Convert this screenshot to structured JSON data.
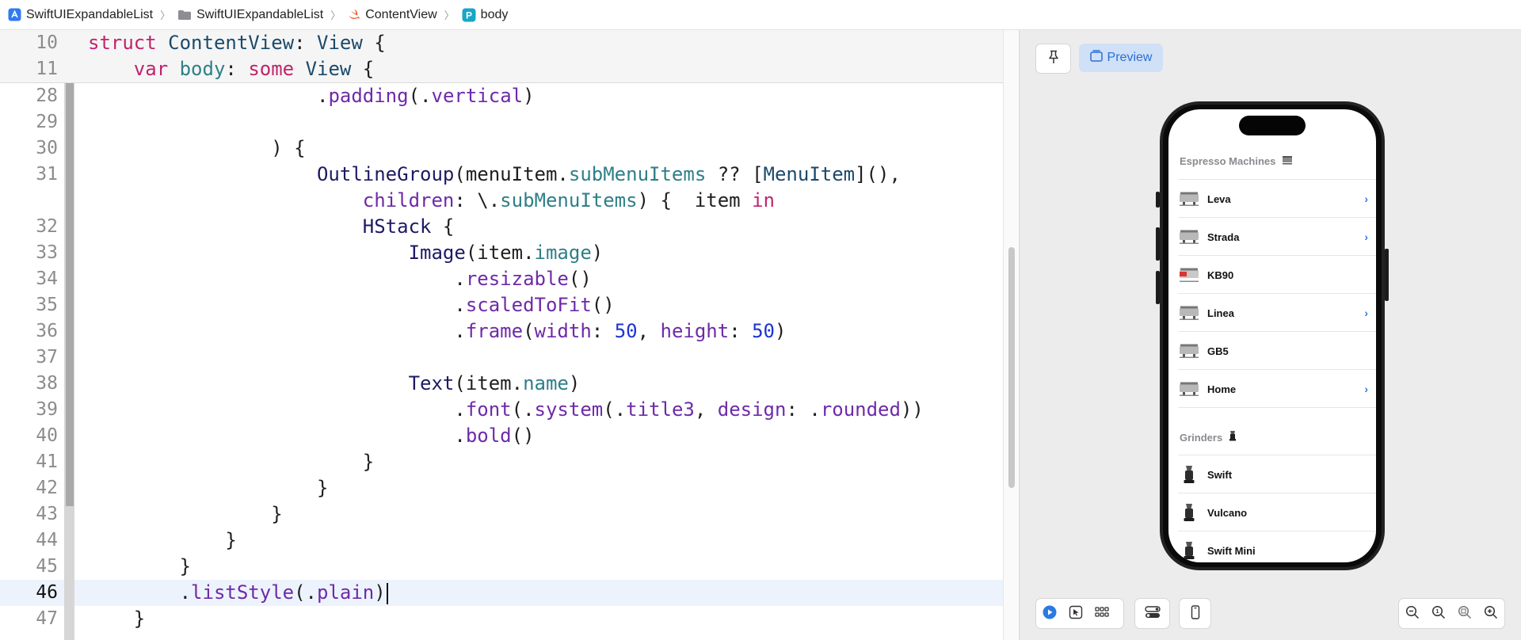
{
  "breadcrumb": [
    {
      "label": "SwiftUIExpandableList",
      "icon": "app-icon"
    },
    {
      "label": "SwiftUIExpandableList",
      "icon": "folder-icon"
    },
    {
      "label": "ContentView",
      "icon": "swift-file-icon"
    },
    {
      "label": "body",
      "icon": "property-icon",
      "badge": "P"
    }
  ],
  "editor": {
    "sticky": [
      {
        "num": "10",
        "code": "struct ContentView: View {"
      },
      {
        "num": "11",
        "code": "    var body: some View {"
      }
    ],
    "lines": [
      {
        "num": "28",
        "code": "                    .padding(.vertical)"
      },
      {
        "num": "29",
        "code": ""
      },
      {
        "num": "30",
        "code": "                ) {"
      },
      {
        "num": "31",
        "code": "                    OutlineGroup(menuItem.subMenuItems ?? [MenuItem](),"
      },
      {
        "num": "",
        "code": "                        children: \\.subMenuItems) {  item in"
      },
      {
        "num": "32",
        "code": "                        HStack {"
      },
      {
        "num": "33",
        "code": "                            Image(item.image)"
      },
      {
        "num": "34",
        "code": "                                .resizable()"
      },
      {
        "num": "35",
        "code": "                                .scaledToFit()"
      },
      {
        "num": "36",
        "code": "                                .frame(width: 50, height: 50)"
      },
      {
        "num": "37",
        "code": ""
      },
      {
        "num": "38",
        "code": "                            Text(item.name)"
      },
      {
        "num": "39",
        "code": "                                .font(.system(.title3, design: .rounded))"
      },
      {
        "num": "40",
        "code": "                                .bold()"
      },
      {
        "num": "41",
        "code": "                        }"
      },
      {
        "num": "42",
        "code": "                    }"
      },
      {
        "num": "43",
        "code": "                }"
      },
      {
        "num": "44",
        "code": "            }"
      },
      {
        "num": "45",
        "code": "        }"
      },
      {
        "num": "46",
        "code": "        .listStyle(.plain)"
      },
      {
        "num": "47",
        "code": "    }"
      }
    ],
    "current_line": "46"
  },
  "preview": {
    "pin_icon": "pin-icon",
    "preview_label": "Preview",
    "sections": [
      {
        "title": "Espresso Machines",
        "items": [
          {
            "name": "Leva",
            "expandable": true
          },
          {
            "name": "Strada",
            "expandable": true
          },
          {
            "name": "KB90",
            "expandable": false
          },
          {
            "name": "Linea",
            "expandable": true
          },
          {
            "name": "GB5",
            "expandable": false
          },
          {
            "name": "Home",
            "expandable": true
          }
        ]
      },
      {
        "title": "Grinders",
        "items": [
          {
            "name": "Swift",
            "expandable": false
          },
          {
            "name": "Vulcano",
            "expandable": false
          },
          {
            "name": "Swift Mini",
            "expandable": false
          }
        ]
      }
    ],
    "chevron": "›",
    "toolbar_left": [
      "play-icon",
      "cursor-icon",
      "grid-icon"
    ],
    "toolbar_mid": [
      "variants-icon"
    ],
    "toolbar_device": [
      "device-icon"
    ],
    "toolbar_zoom": [
      "zoom-out-icon",
      "zoom-actual-icon",
      "zoom-fit-icon",
      "zoom-in-icon"
    ]
  },
  "colors": {
    "keyword": "#c0236e",
    "type": "#1b4a6b",
    "method": "#6e2aa8",
    "property": "#2e7f87",
    "number": "#1d33d4",
    "accent": "#2a7ae2",
    "current_line_bg": "#edf3fc"
  }
}
